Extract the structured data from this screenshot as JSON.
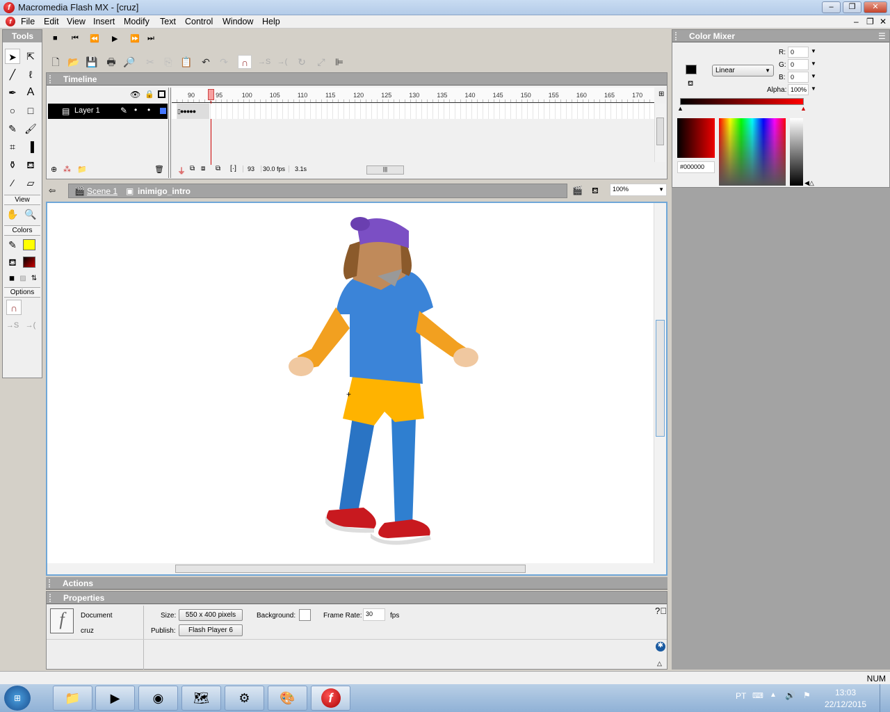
{
  "window": {
    "title": "Macromedia Flash MX - [cruz]",
    "app_icon": "flash-logo"
  },
  "menu": [
    "File",
    "Edit",
    "View",
    "Insert",
    "Modify",
    "Text",
    "Control",
    "Window",
    "Help"
  ],
  "tools": {
    "title": "Tools",
    "view_label": "View",
    "colors_label": "Colors",
    "options_label": "Options",
    "stroke_color": "#ffff00",
    "fill_color": "#8b0000"
  },
  "timeline": {
    "title": "Timeline",
    "layer": "Layer 1",
    "ruler": [
      "90",
      "95",
      "100",
      "105",
      "110",
      "115",
      "120",
      "125",
      "130",
      "135",
      "140",
      "145",
      "150",
      "155",
      "160",
      "165",
      "170"
    ],
    "current_frame": "93",
    "frame_rate": "30.0 fps",
    "elapsed": "3.1s"
  },
  "editbar": {
    "scene": "Scene 1",
    "symbol": "inimigo_intro",
    "zoom": "100%"
  },
  "panels": {
    "actions": "Actions",
    "properties": "Properties"
  },
  "properties": {
    "type": "Document",
    "name": "cruz",
    "size_label": "Size:",
    "size": "550 x 400 pixels",
    "publish_label": "Publish:",
    "publish": "Flash Player 6",
    "background_label": "Background:",
    "background": "#ffffff",
    "framerate_label": "Frame Rate:",
    "framerate": "30",
    "fps": "fps"
  },
  "mixer": {
    "title": "Color Mixer",
    "fill_type": "Linear",
    "r_label": "R:",
    "r": "0",
    "g_label": "G:",
    "g": "0",
    "b_label": "B:",
    "b": "0",
    "alpha_label": "Alpha:",
    "alpha": "100%",
    "hex": "#000000",
    "gradient": [
      "#000000",
      "#ff0000"
    ]
  },
  "status": {
    "num": "NUM"
  },
  "taskbar": {
    "lang": "PT",
    "time": "13:03",
    "date": "22/12/2015"
  }
}
